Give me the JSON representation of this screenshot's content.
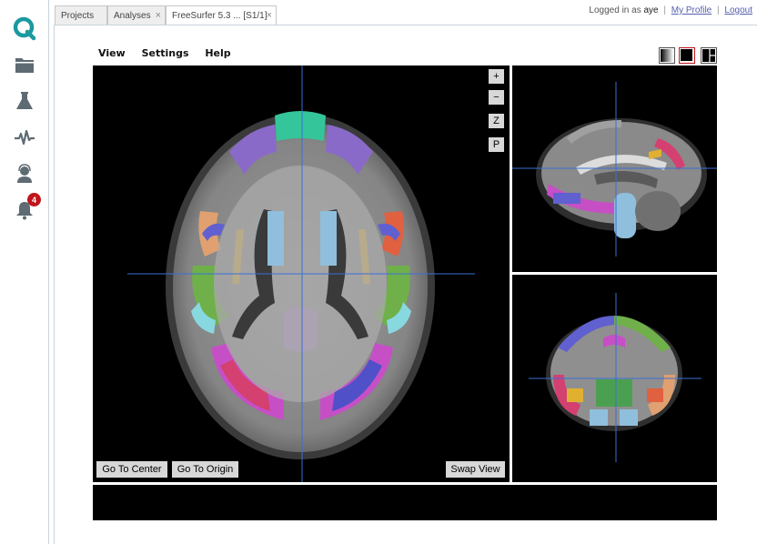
{
  "sidebar": {
    "logo": "q-logo-icon",
    "items": [
      {
        "icon": "folder-icon"
      },
      {
        "icon": "flask-icon"
      },
      {
        "icon": "activity-icon"
      },
      {
        "icon": "support-agent-icon"
      },
      {
        "icon": "bell-icon",
        "badge": "4"
      }
    ]
  },
  "tabs": [
    {
      "label": "Projects",
      "closable": false
    },
    {
      "label": "Analyses",
      "closable": true
    },
    {
      "label": "FreeSurfer 5.3 ... [S1/1]",
      "closable": true,
      "active": true
    }
  ],
  "tab_close_glyph": "×",
  "user": {
    "logged_in_as": "Logged in as",
    "username": "aye",
    "profile_link": "My Profile",
    "separator": "|",
    "logout_link": "Logout"
  },
  "menu": {
    "items": [
      "View",
      "Settings",
      "Help"
    ]
  },
  "layout_buttons": [
    "layout-gradient-icon",
    "layout-single-icon",
    "layout-split-icon"
  ],
  "viewer": {
    "zoom_in": "+",
    "zoom_out": "−",
    "z_button": "Z",
    "p_button": "P",
    "go_to_center": "Go To Center",
    "go_to_origin": "Go To Origin",
    "swap_view": "Swap View"
  },
  "colors": {
    "accent_teal": "#1a9aa0",
    "sidebar_icon": "#5e6b73",
    "badge": "#c0151b",
    "crosshair": "#3a6fd6"
  }
}
